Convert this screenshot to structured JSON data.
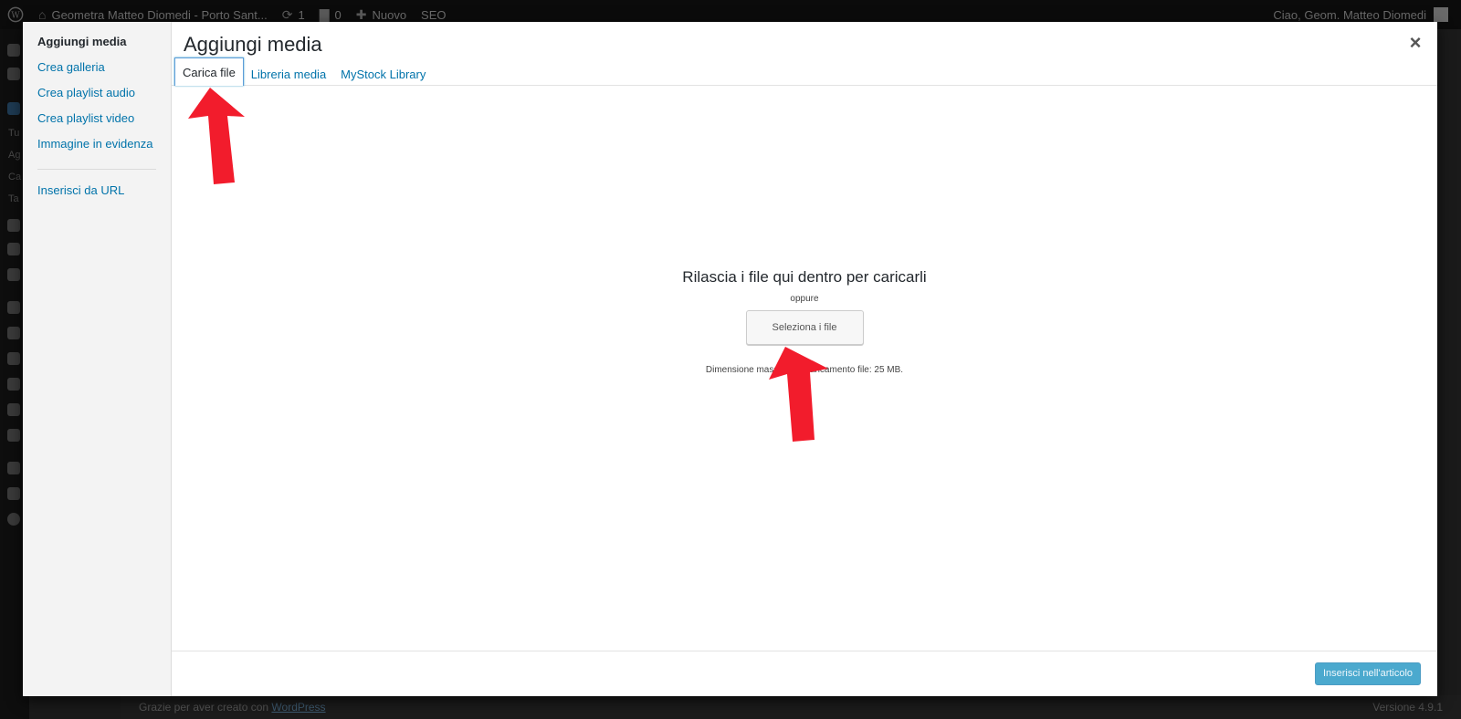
{
  "admin_bar": {
    "site_name": "Geometra Matteo Diomedi - Porto Sant...",
    "updates_count": "1",
    "comments_count": "0",
    "new_label": "Nuovo",
    "seo_label": "SEO",
    "greeting": "Ciao, Geom. Matteo Diomedi"
  },
  "admin_side": [
    "Tu",
    "Ag",
    "Ca",
    "Ta"
  ],
  "modal": {
    "menu": {
      "items": [
        {
          "label": "Aggiungi media"
        },
        {
          "label": "Crea galleria"
        },
        {
          "label": "Crea playlist audio"
        },
        {
          "label": "Crea playlist video"
        },
        {
          "label": "Immagine in evidenza"
        }
      ],
      "url_item": "Inserisci da URL"
    },
    "title": "Aggiungi media",
    "close_glyph": "×",
    "tabs": [
      {
        "label": "Carica file"
      },
      {
        "label": "Libreria media"
      },
      {
        "label": "MyStock Library"
      }
    ],
    "uploader": {
      "instructions": "Rilascia i file qui dentro per caricarli",
      "or": "oppure",
      "select_button": "Seleziona i file",
      "max_size": "Dimensione massima di caricamento file: 25 MB."
    },
    "insert_button": "Inserisci nell'articolo"
  },
  "footer": {
    "thanks_text": "Grazie per aver creato con",
    "thanks_link": "WordPress",
    "version": "Versione 4.9.1"
  },
  "colors": {
    "link": "#0073aa",
    "primary_button": "#0085ba",
    "arrow": "#f21c2c"
  }
}
